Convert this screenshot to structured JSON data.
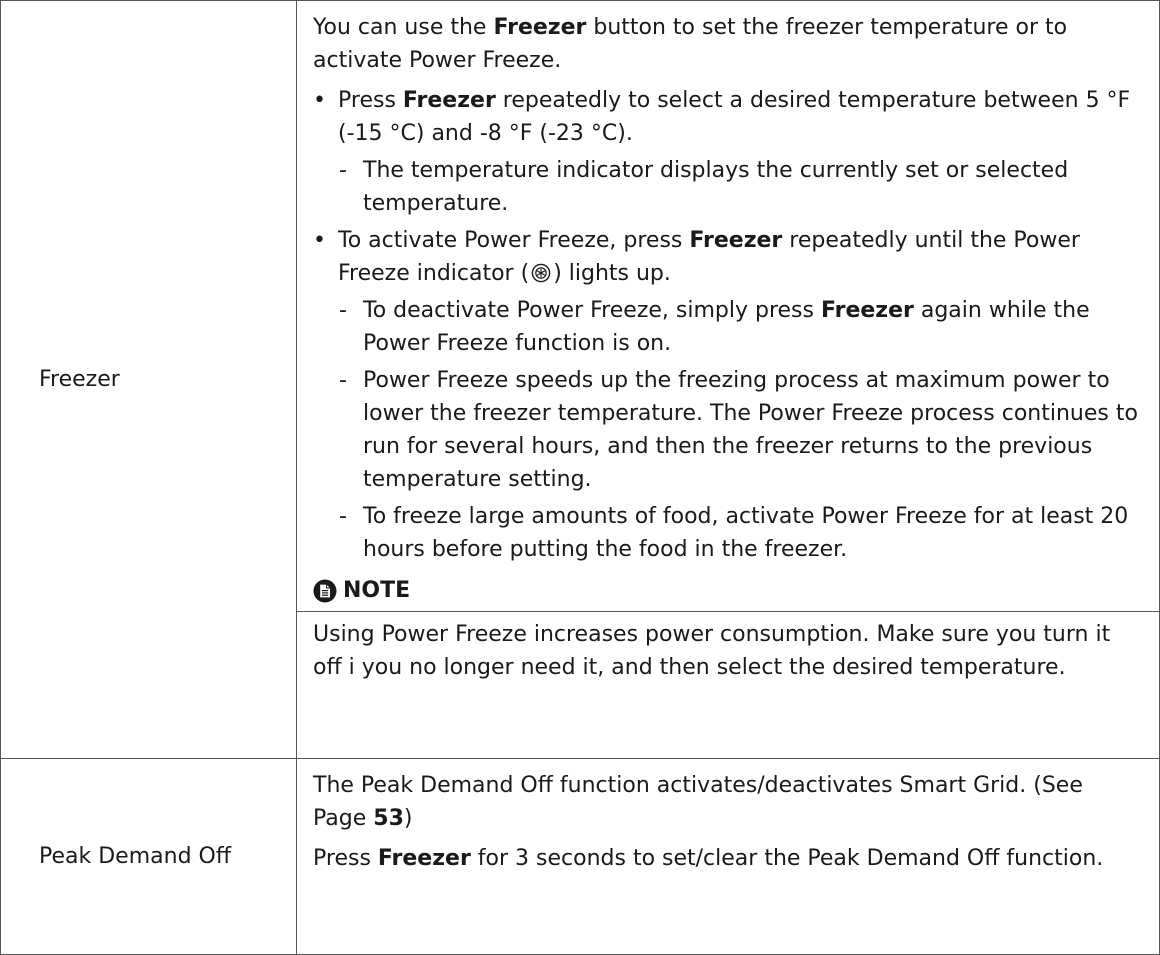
{
  "freezer_row": {
    "label": "Freezer",
    "intro_1": "You can use the ",
    "intro_bold": "Freezer",
    "intro_2": " button to set the freezer temperature or to activate Power Freeze.",
    "bullets": [
      {
        "mark": "•",
        "text_1": "Press ",
        "bold": "Freezer",
        "text_2": " repeatedly to select a desired temperature between 5 °F (-15 °C) and -8 °F (-23 °C).",
        "dashes": [
          {
            "mark": "-",
            "text": "The temperature indicator displays the currently set or selected temperature."
          }
        ]
      },
      {
        "mark": "•",
        "text_1": "To activate Power Freeze, press ",
        "bold": "Freezer",
        "text_2": " repeatedly until the Power Freeze indicator (",
        "text_3": ") lights up.",
        "indicator_icon": "power-freeze-indicator-icon",
        "dashes": [
          {
            "mark": "-",
            "text_1": "To deactivate Power Freeze, simply press ",
            "bold": "Freezer",
            "text_2": " again while the Power Freeze function is on."
          },
          {
            "mark": "-",
            "text": "Power Freeze speeds up the freezing process at maximum power to lower the freezer temperature. The Power Freeze process continues to run for several hours, and then the freezer returns to the previous temperature setting."
          },
          {
            "mark": "-",
            "text": "To freeze large amounts of food, activate Power Freeze for at least 20 hours before putting the food in the freezer."
          }
        ]
      }
    ],
    "note": {
      "icon": "note-document-icon",
      "heading": "NOTE",
      "text": "Using Power Freeze increases power consumption. Make sure you turn it off i you no longer need it, and then select the desired temperature."
    }
  },
  "peak_row": {
    "label": "Peak Demand Off",
    "para1_text": "The Peak Demand Off function activates/deactivates Smart Grid. (See Page ",
    "para1_page": "53",
    "para1_end": ")",
    "para2_1": "Press ",
    "para2_bold": "Freezer",
    "para2_2": " for 3 seconds to set/clear the Peak Demand Off function."
  }
}
